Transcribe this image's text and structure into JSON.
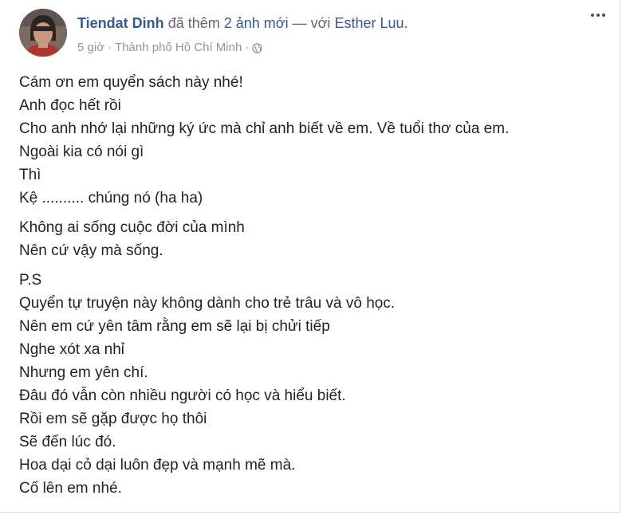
{
  "post": {
    "author": "Tiendat Dinh",
    "action_prefix": "đã thêm",
    "action_count": "2 ảnh mới",
    "separator": "— với",
    "tagged_user": "Esther Luu.",
    "time": "5 giờ",
    "dot": "·",
    "location": "Thành phố Hồ Chí Minh",
    "dot2": "·",
    "privacy_icon": "globe-icon",
    "more_icon": "more-options-icon"
  },
  "paragraphs": [
    {
      "lines": [
        "Cám ơn em quyển sách này nhé!",
        "Anh đọc hết rồi",
        "Cho anh nhớ lại những ký ức mà chỉ anh biết về em. Về tuổi thơ của em.",
        "Ngoài kia có nói gì",
        "Thì",
        "Kệ .......... chúng nó (ha ha)"
      ]
    },
    {
      "lines": [
        "Không ai sống cuộc đời của mình",
        "Nên cứ vậy mà sống."
      ]
    },
    {
      "lines": [
        "P.S",
        "Quyển tự truyện này không dành cho trẻ trâu và vô học.",
        "Nên em cứ yên tâm rằng em sẽ lại bị chửi tiếp",
        "Nghe xót xa nhỉ",
        "Nhưng em yên chí.",
        "Đâu đó vẫn còn nhiều người có học và hiểu biết.",
        "Rồi em sẽ gặp được họ thôi",
        "Sẽ đến lúc đó.",
        "Hoa dại cỏ dại luôn đẹp và mạnh mẽ mà.",
        "Cố lên em nhé."
      ]
    }
  ]
}
